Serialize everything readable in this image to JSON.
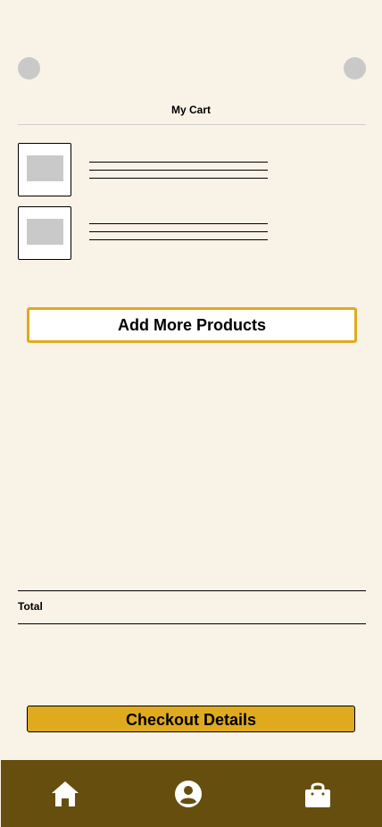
{
  "header": {
    "title": "My Cart"
  },
  "cart": {
    "items": [
      {
        "name": "",
        "placeholder": true
      },
      {
        "name": "",
        "placeholder": true
      }
    ],
    "add_more_label": "Add More Products"
  },
  "summary": {
    "total_label": "Total"
  },
  "actions": {
    "checkout_label": "Checkout Details"
  },
  "bottom_nav": {
    "items": [
      {
        "icon": "home-icon"
      },
      {
        "icon": "profile-icon"
      },
      {
        "icon": "shopping-bag-icon"
      }
    ]
  },
  "colors": {
    "background": "#f9f2e7",
    "accent": "#e0aa1f",
    "nav_background": "#664f0e",
    "placeholder_gray": "#c9c9c9"
  }
}
